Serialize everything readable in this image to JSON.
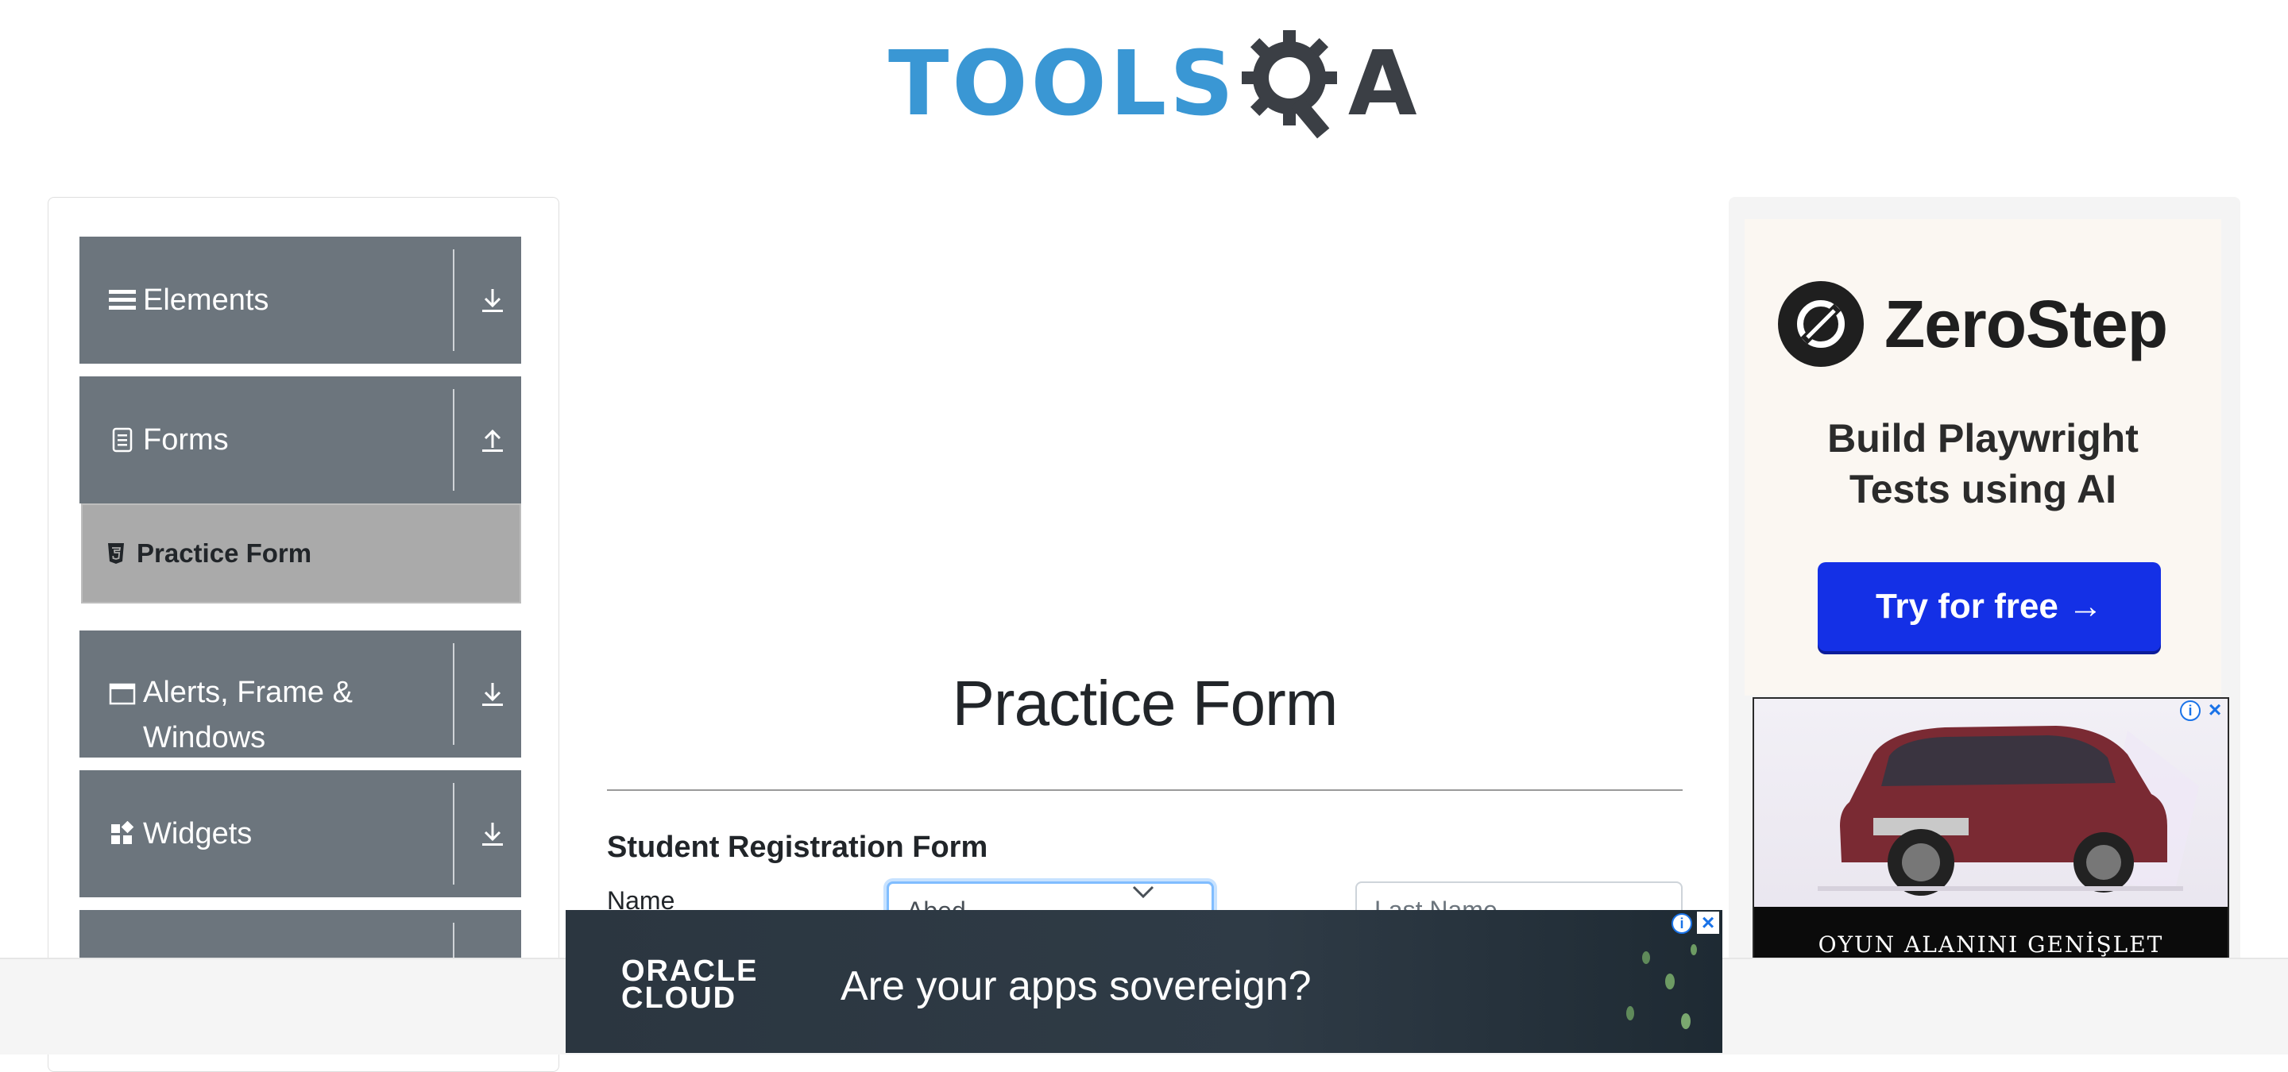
{
  "header": {
    "logo_text_tools": "TOOLS",
    "logo_text_a": "A"
  },
  "sidebar": {
    "groups": [
      {
        "label": "Elements",
        "icon": "menu-icon",
        "arrow": "download-icon"
      },
      {
        "label": "Forms",
        "icon": "document-icon",
        "arrow": "upload-icon",
        "items": [
          {
            "label": "Practice Form",
            "icon": "html5-icon"
          }
        ]
      },
      {
        "label": "Alerts, Frame & Windows",
        "icon": "window-icon",
        "arrow": "download-icon"
      },
      {
        "label": "Widgets",
        "icon": "widgets-icon",
        "arrow": "download-icon"
      }
    ]
  },
  "main": {
    "title": "Practice Form",
    "form": {
      "heading": "Student Registration Form",
      "name_label": "Name",
      "first_name_value": "Abed",
      "last_name_placeholder": "Last Name"
    }
  },
  "ads": {
    "zerostep": {
      "brand": "ZeroStep",
      "tagline_line1": "Build Playwright",
      "tagline_line2": "Tests using AI",
      "cta": "Try for free →"
    },
    "car": {
      "caption": "OYUN ALANINI GENİŞLET"
    },
    "oracle": {
      "logo_line1": "ORACLE",
      "logo_line2": "CLOUD",
      "text": "Are your apps sovereign?"
    }
  },
  "colors": {
    "sidebar": "#6c757d",
    "active_item": "#aaaaaa",
    "logo_blue": "#3a97d4",
    "cta_blue": "#1430e6"
  }
}
